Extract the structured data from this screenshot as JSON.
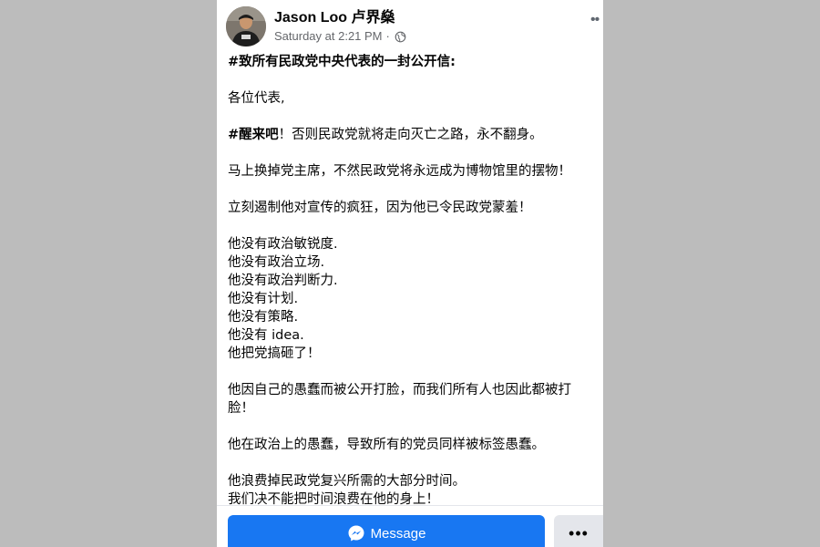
{
  "post": {
    "author": "Jason Loo 卢界燊",
    "timestamp": "Saturday at 2:21 PM",
    "separator": "·",
    "visibility_icon": "globe-icon",
    "avatar_icon": "profile-photo",
    "more_icon": "ellipsis-icon",
    "more_label": "••",
    "body": {
      "p1": "#致所有民政党中央代表的一封公开信:",
      "p2": "各位代表,",
      "p3_bold": "#醒来吧",
      "p3_rest": "！否则民政党就将走向灭亡之路，永不翻身。",
      "p4": "马上换掉党主席，不然民政党将永远成为博物馆里的摆物！",
      "p5": "立刻遏制他对宣传的疯狂，因为他已令民政党蒙羞！",
      "p6": [
        "他没有政治敏锐度.",
        "他没有政治立场.",
        "他没有政治判断力.",
        "他没有计划.",
        "他没有策略.",
        "他没有 idea.",
        "他把党搞砸了！"
      ],
      "p7": "他因自己的愚蠢而被公开打脸，而我们所有人也因此都被打脸！",
      "p8": "他在政治上的愚蠢，导致所有的党员同样被标签愚蠢。",
      "p9": [
        "他浪费掉民政党复兴所需的大部分时间。",
        "我们决不能把时间浪费在他的身上！"
      ]
    }
  },
  "actions": {
    "message_label": "Message",
    "message_icon": "messenger-icon",
    "more_label": "•••",
    "more_icon": "ellipsis-icon"
  },
  "colors": {
    "page_background": "#bcbcbc",
    "card_background": "#ffffff",
    "primary_blue": "#1877f2",
    "secondary_button": "#e4e6eb",
    "meta_text": "#65676b",
    "body_text": "#050505"
  }
}
